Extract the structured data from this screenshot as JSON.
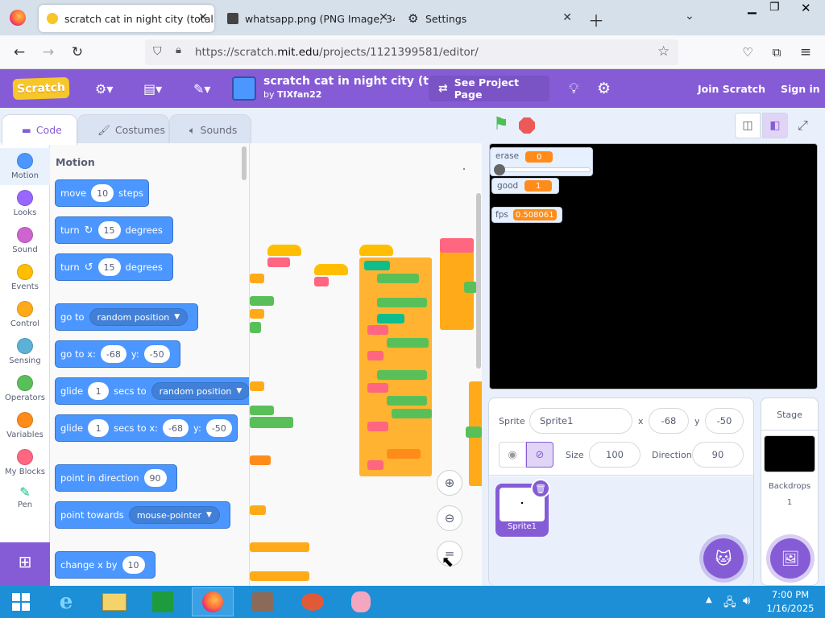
{
  "browser": {
    "tabs": [
      {
        "title": "scratch cat in night city (totally"
      },
      {
        "title": "whatsapp.png (PNG Image, 34"
      },
      {
        "title": "Settings"
      }
    ],
    "url_prefix": "https://scratch.",
    "url_domain": "mit.edu",
    "url_suffix": "/projects/1121399581/editor/"
  },
  "header": {
    "logo_text": "Scratch",
    "project_title": "scratch cat in night city (t...",
    "author": "TIXfan22",
    "see_project_page": "See Project Page",
    "join": "Join Scratch",
    "signin": "Sign in"
  },
  "editor_tabs": {
    "code": "Code",
    "costumes": "Costumes",
    "sounds": "Sounds"
  },
  "categories": [
    {
      "label": "Motion",
      "color": "#4c97ff"
    },
    {
      "label": "Looks",
      "color": "#9966ff"
    },
    {
      "label": "Sound",
      "color": "#cf63cf"
    },
    {
      "label": "Events",
      "color": "#ffbf00"
    },
    {
      "label": "Control",
      "color": "#ffab19"
    },
    {
      "label": "Sensing",
      "color": "#5cb1d6"
    },
    {
      "label": "Operators",
      "color": "#59c059"
    },
    {
      "label": "Variables",
      "color": "#ff8c1a"
    },
    {
      "label": "My Blocks",
      "color": "#ff6680"
    },
    {
      "label": "Pen",
      "color": ""
    }
  ],
  "palette": {
    "heading": "Motion",
    "move": {
      "a": "move",
      "v": "10",
      "b": "steps"
    },
    "turn_right": {
      "a": "turn",
      "v": "15",
      "b": "degrees"
    },
    "turn_left": {
      "a": "turn",
      "v": "15",
      "b": "degrees"
    },
    "goto": {
      "a": "go to",
      "v": "random position"
    },
    "goto_xy": {
      "a": "go to x:",
      "x": "-68",
      "ylab": "y:",
      "y": "-50"
    },
    "glide_to": {
      "a": "glide",
      "v": "1",
      "b": "secs to",
      "target": "random position"
    },
    "glide_xy": {
      "a": "glide",
      "v": "1",
      "b": "secs to x:",
      "x": "-68",
      "ylab": "y:",
      "y": "-50"
    },
    "point_dir": {
      "a": "point in direction",
      "v": "90"
    },
    "point_towards": {
      "a": "point towards",
      "v": "mouse-pointer"
    },
    "change_x": {
      "a": "change x by",
      "v": "10"
    }
  },
  "monitors": {
    "erase": {
      "label": "erase",
      "value": "0"
    },
    "good": {
      "label": "good",
      "value": "1"
    },
    "fps": {
      "label": "fps",
      "value": "0.508061"
    }
  },
  "sprite_info": {
    "sprite_label": "Sprite",
    "sprite_name": "Sprite1",
    "x_label": "x",
    "x": "-68",
    "y_label": "y",
    "y": "-50",
    "show_label": "Show",
    "size_label": "Size",
    "size": "100",
    "direction_label": "Direction",
    "direction": "90",
    "thumb_name": "Sprite1"
  },
  "stage_pane": {
    "title": "Stage",
    "backdrops_label": "Backdrops",
    "backdrops_count": "1"
  },
  "taskbar": {
    "time": "7:00 PM",
    "date": "1/16/2025"
  }
}
